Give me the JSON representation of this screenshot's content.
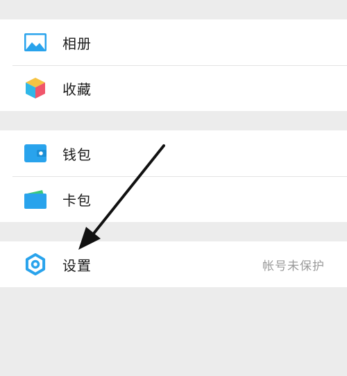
{
  "groups": [
    {
      "items": [
        {
          "label": "相册",
          "icon": "album-icon"
        },
        {
          "label": "收藏",
          "icon": "favorites-icon"
        }
      ]
    },
    {
      "items": [
        {
          "label": "钱包",
          "icon": "wallet-icon"
        },
        {
          "label": "卡包",
          "icon": "card-wallet-icon"
        }
      ]
    },
    {
      "items": [
        {
          "label": "设置",
          "icon": "settings-gear-icon",
          "note": "帐号未保护"
        }
      ]
    }
  ],
  "colors": {
    "accent_blue": "#29a3ec",
    "page_bg": "#ececec",
    "card_bg": "#ffffff",
    "note_gray": "#9a9a9a"
  }
}
